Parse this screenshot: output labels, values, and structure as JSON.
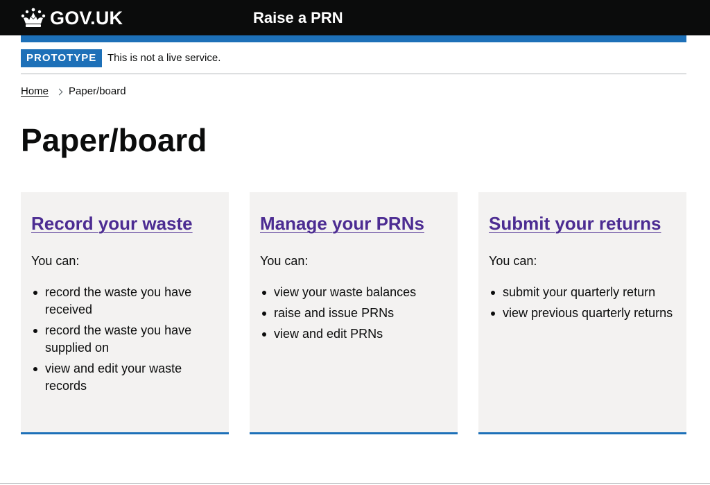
{
  "header": {
    "logo_text": "GOV.UK",
    "logo_icon": "crown-icon",
    "service_name": "Raise a PRN"
  },
  "phase_banner": {
    "tag": "PROTOTYPE",
    "text": "This is not a live service."
  },
  "breadcrumbs": {
    "items": [
      {
        "label": "Home"
      },
      {
        "label": "Paper/board"
      }
    ]
  },
  "page": {
    "title": "Paper/board"
  },
  "cards": [
    {
      "title": "Record your waste",
      "intro": "You can:",
      "items": [
        "record the waste you have received",
        "record the waste you have supplied on",
        "view and edit your waste records"
      ]
    },
    {
      "title": "Manage your PRNs",
      "intro": "You can:",
      "items": [
        "view your waste balances",
        "raise and issue PRNs",
        "view and edit PRNs"
      ]
    },
    {
      "title": "Submit your returns",
      "intro": "You can:",
      "items": [
        "submit your quarterly return",
        "view previous quarterly returns"
      ]
    }
  ],
  "colors": {
    "header_bg": "#0b0c0c",
    "brand_blue": "#1d70b8",
    "link_visited": "#4c2c92",
    "card_bg": "#f3f2f1"
  }
}
